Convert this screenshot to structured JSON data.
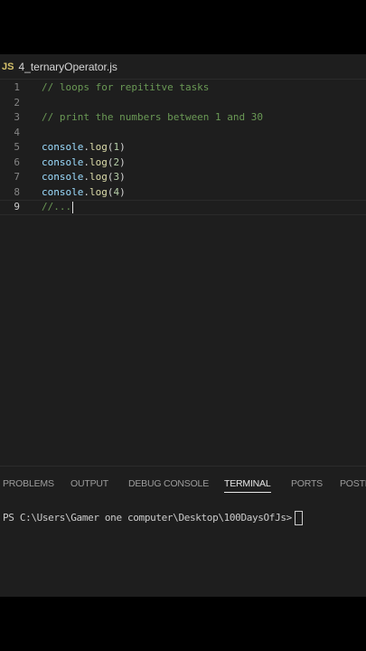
{
  "editor": {
    "tab": {
      "icon": "JS",
      "filename": "4_ternaryOperator.js"
    },
    "lines": [
      {
        "number": "1",
        "text": "// loops for repititve tasks",
        "kind": "comment"
      },
      {
        "number": "2",
        "text": "",
        "kind": "empty"
      },
      {
        "number": "3",
        "text": "// print the numbers between 1 and 30",
        "kind": "comment"
      },
      {
        "number": "4",
        "text": "",
        "kind": "empty"
      },
      {
        "number": "5",
        "obj": "console",
        "dot": ".",
        "method": "log",
        "open": "(",
        "arg": "1",
        "close": ")",
        "kind": "code"
      },
      {
        "number": "6",
        "obj": "console",
        "dot": ".",
        "method": "log",
        "open": "(",
        "arg": "2",
        "close": ")",
        "kind": "code"
      },
      {
        "number": "7",
        "obj": "console",
        "dot": ".",
        "method": "log",
        "open": "(",
        "arg": "3",
        "close": ")",
        "kind": "code"
      },
      {
        "number": "8",
        "obj": "console",
        "dot": ".",
        "method": "log",
        "open": "(",
        "arg": "4",
        "close": ")",
        "kind": "code"
      },
      {
        "number": "9",
        "text": "//...",
        "kind": "comment"
      }
    ]
  },
  "panel": {
    "tabs": [
      "PROBLEMS",
      "OUTPUT",
      "DEBUG CONSOLE",
      "TERMINAL",
      "PORTS",
      "POSTMAN"
    ],
    "active_tab": "TERMINAL",
    "terminal": {
      "prompt": "PS C:\\Users\\Gamer one computer\\Desktop\\100DaysOfJs>"
    }
  },
  "colors": {
    "comment": "#6a9955",
    "identifier": "#9cdcfe",
    "method": "#dcdcaa",
    "number": "#b5cea8",
    "js_icon": "#d6c26b",
    "editor_bg": "#1e1e1e"
  }
}
